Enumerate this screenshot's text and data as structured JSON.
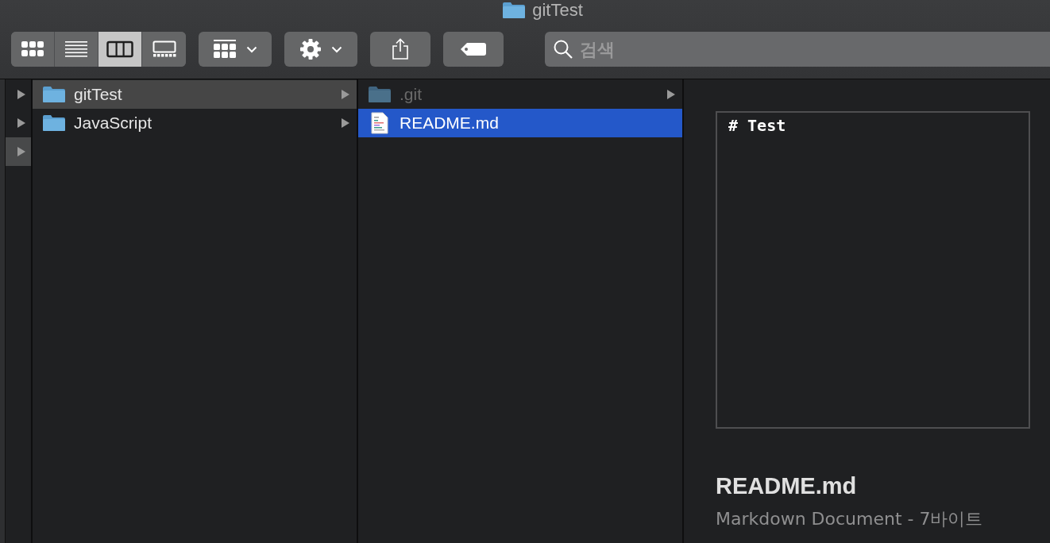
{
  "window": {
    "title": "gitTest"
  },
  "toolbar": {
    "view_modes": [
      {
        "kind": "icons",
        "selected": false
      },
      {
        "kind": "list",
        "selected": false
      },
      {
        "kind": "columns",
        "selected": true
      },
      {
        "kind": "gallery",
        "selected": false
      }
    ],
    "search": {
      "placeholder": "검색"
    }
  },
  "columns": [
    {
      "active": false,
      "items": [
        {
          "selected": false
        },
        {
          "selected": false
        },
        {
          "selected": true
        }
      ]
    },
    {
      "active": false,
      "items": [
        {
          "name": "gitTest",
          "kind": "folder",
          "hidden": false,
          "selected": true
        },
        {
          "name": "JavaScript",
          "kind": "folder",
          "hidden": false,
          "selected": false
        }
      ]
    },
    {
      "active": true,
      "items": [
        {
          "name": ".git",
          "kind": "folder",
          "hidden": true,
          "selected": false
        },
        {
          "name": "README.md",
          "kind": "file",
          "hidden": false,
          "selected": true
        }
      ]
    }
  ],
  "preview": {
    "content": "# Test",
    "name": "README.md",
    "info": "Markdown Document - 7바이트"
  }
}
